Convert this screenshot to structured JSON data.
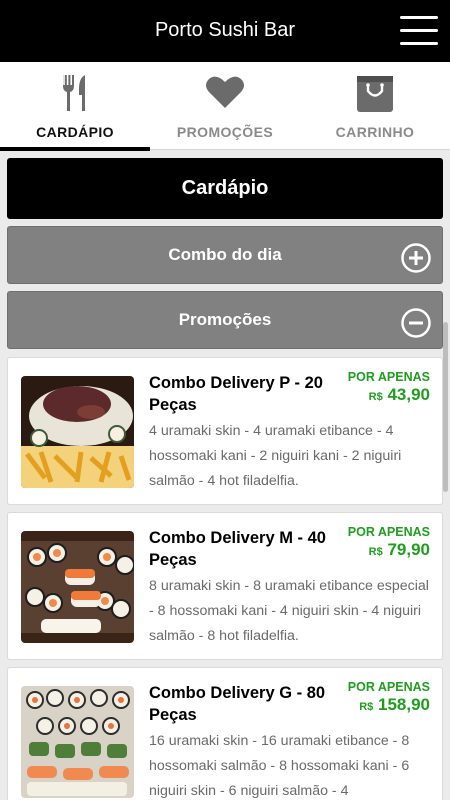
{
  "app": {
    "title": "Porto Sushi Bar"
  },
  "tabs": [
    {
      "label": "CARDÁPIO",
      "icon": "fork-knife-icon",
      "active": true
    },
    {
      "label": "PROMOÇÕES",
      "icon": "heart-icon",
      "active": false
    },
    {
      "label": "CARRINHO",
      "icon": "shopping-bag-icon",
      "active": false
    }
  ],
  "menu": {
    "header": "Cardápio",
    "sections": [
      {
        "label": "Combo do dia",
        "state": "collapsed",
        "icon": "plus-circle-icon"
      },
      {
        "label": "Promoções",
        "state": "expanded",
        "icon": "minus-circle-icon"
      }
    ]
  },
  "products": [
    {
      "name": "Combo Delivery P - 20 Peças",
      "tag": "POR APENAS",
      "currency": "R$",
      "price": "43,90",
      "description": "4 uramaki skin - 4 uramaki etibance - 4 hossomaki kani - 2 niguiri kani - 2 niguiri salmão - 4 hot filadelfia."
    },
    {
      "name": "Combo Delivery M - 40 Peças",
      "tag": "POR APENAS",
      "currency": "R$",
      "price": "79,90",
      "description": "8 uramaki skin - 8 uramaki etibance especial - 8 hossomaki kani - 4 niguiri skin - 4 niguiri salmão - 8 hot filadelfia."
    },
    {
      "name": "Combo Delivery G - 80 Peças",
      "tag": "POR APENAS",
      "currency": "R$",
      "price": "158,90",
      "description": "16 uramaki skin - 16 uramaki etibance - 8 hossomaki salmão - 8 hossomaki kani - 6 niguiri skin - 6 niguiri salmão - 4"
    }
  ],
  "colors": {
    "header": "#000000",
    "price": "#1e9e1e",
    "section": "#818181"
  }
}
